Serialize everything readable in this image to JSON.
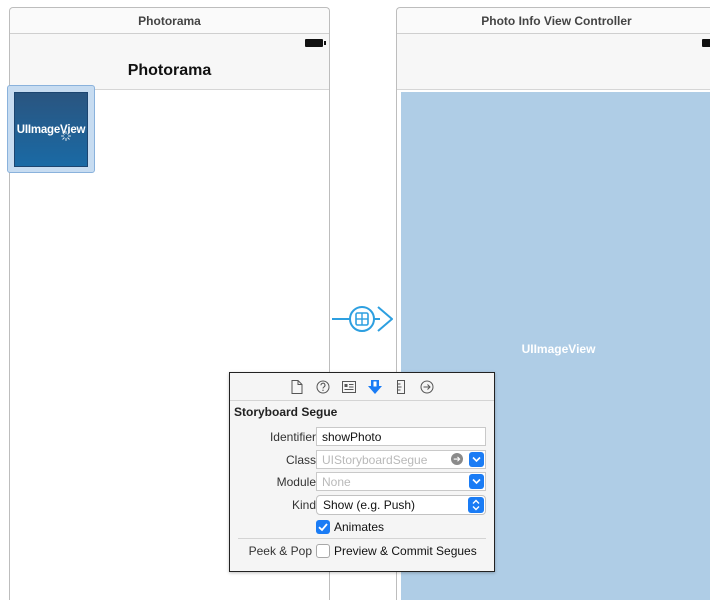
{
  "scenes": {
    "left": {
      "title": "Photorama",
      "nav_title": "Photorama",
      "image_view_label": "UIImageView"
    },
    "right": {
      "title": "Photo Info View Controller",
      "image_view_label": "UIImageView"
    }
  },
  "inspector": {
    "tabs": [
      {
        "name": "file-inspector-icon"
      },
      {
        "name": "quick-help-icon"
      },
      {
        "name": "identity-inspector-icon"
      },
      {
        "name": "attributes-inspector-icon",
        "selected": true
      },
      {
        "name": "size-inspector-icon"
      },
      {
        "name": "connections-inspector-icon"
      }
    ],
    "section_title": "Storyboard Segue",
    "identifier": {
      "label": "Identifier",
      "value": "showPhoto"
    },
    "class": {
      "label": "Class",
      "placeholder": "UIStoryboardSegue"
    },
    "module": {
      "label": "Module",
      "placeholder": "None"
    },
    "kind": {
      "label": "Kind",
      "value": "Show (e.g. Push)"
    },
    "animates": {
      "label": "Animates",
      "checked": true
    },
    "peek_pop": {
      "label": "Peek & Pop",
      "option_label": "Preview & Commit Segues",
      "checked": false
    }
  },
  "colors": {
    "accent": "#1a7cf5",
    "segue": "#2d9fe0",
    "image_view_bg": "#afcde6"
  }
}
